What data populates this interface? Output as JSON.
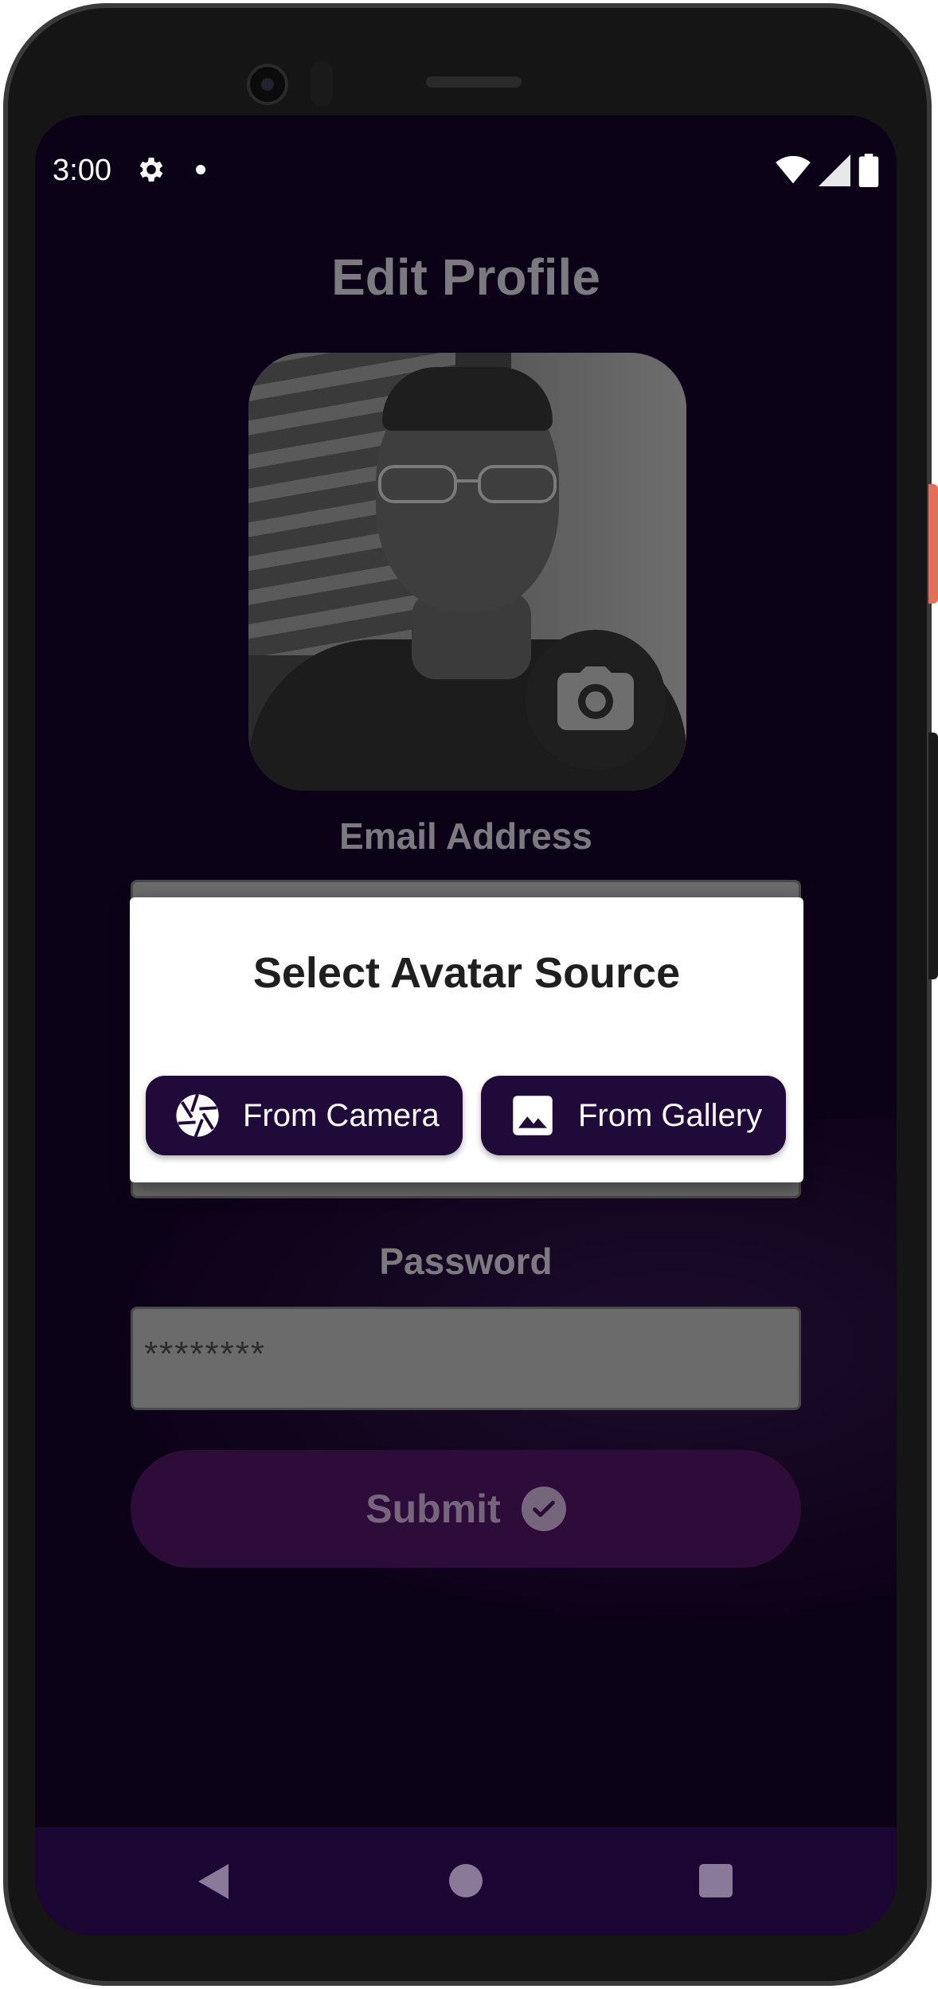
{
  "status_bar": {
    "time": "3:00",
    "icons": [
      "gear-icon",
      "notification-dot-icon",
      "wifi-icon",
      "signal-icon",
      "battery-icon"
    ]
  },
  "page": {
    "title": "Edit Profile"
  },
  "avatar": {
    "change_icon": "camera-icon"
  },
  "form": {
    "email_label": "Email Address",
    "password_label": "Password",
    "password_value": "********",
    "submit_label": "Submit",
    "submit_icon": "check-circle-icon"
  },
  "dialog": {
    "title": "Select Avatar Source",
    "camera_button": {
      "label": "From Camera",
      "icon": "camera-aperture-icon"
    },
    "gallery_button": {
      "label": "From Gallery",
      "icon": "image-icon"
    }
  },
  "nav_bar": {
    "buttons": [
      "back-icon",
      "home-icon",
      "recents-icon"
    ]
  },
  "colors": {
    "screen_bg": "#0c0218",
    "dialog_button_bg": "#1f0a3a",
    "submit_bg": "#2e0c3a",
    "nav_bg": "#1c0633"
  }
}
